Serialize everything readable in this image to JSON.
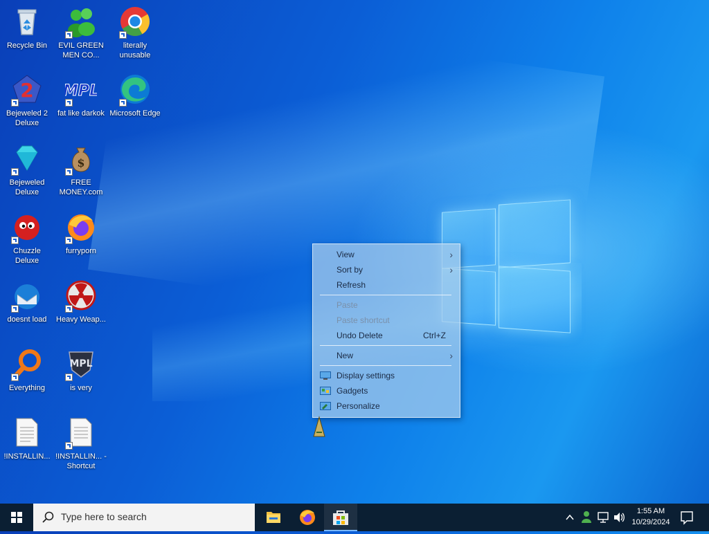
{
  "desktop_icons": [
    {
      "label": "Recycle Bin",
      "icon": "recycle-bin-icon",
      "shortcut": false
    },
    {
      "label": "EVIL GREEN MEN CO...",
      "icon": "green-men-icon",
      "shortcut": true
    },
    {
      "label": "literally unusable",
      "icon": "chrome-icon",
      "shortcut": true
    },
    {
      "label": "Bejeweled 2 Deluxe",
      "icon": "bejeweled-2-icon",
      "shortcut": true
    },
    {
      "label": "fat like darkok",
      "icon": "mpl-icon",
      "shortcut": true
    },
    {
      "label": "Microsoft Edge",
      "icon": "edge-icon",
      "shortcut": true
    },
    {
      "label": "Bejeweled Deluxe",
      "icon": "diamond-icon",
      "shortcut": true
    },
    {
      "label": "FREE MONEY.com",
      "icon": "money-bag-icon",
      "shortcut": true
    },
    {
      "label": "Chuzzle Deluxe",
      "icon": "chuzzle-icon",
      "shortcut": true
    },
    {
      "label": "furryporn",
      "icon": "firefox-icon",
      "shortcut": true
    },
    {
      "label": "doesnt load",
      "icon": "thunderbird-icon",
      "shortcut": true
    },
    {
      "label": "Heavy Weap...",
      "icon": "radiation-icon",
      "shortcut": true
    },
    {
      "label": "Everything",
      "icon": "search-magnifier-icon",
      "shortcut": true
    },
    {
      "label": "is very",
      "icon": "mpl-shield-icon",
      "shortcut": true
    },
    {
      "label": "!INSTALLIN...",
      "icon": "text-file-icon",
      "shortcut": false
    },
    {
      "label": "!INSTALLIN... - Shortcut",
      "icon": "text-file-icon",
      "shortcut": true
    }
  ],
  "context_menu": {
    "items": [
      {
        "label": "View",
        "submenu": true,
        "disabled": false
      },
      {
        "label": "Sort by",
        "submenu": true,
        "disabled": false
      },
      {
        "label": "Refresh",
        "disabled": false
      },
      {
        "label": "Paste",
        "disabled": true
      },
      {
        "label": "Paste shortcut",
        "disabled": true
      },
      {
        "label": "Undo Delete",
        "shortcut": "Ctrl+Z",
        "disabled": false
      },
      {
        "label": "New",
        "submenu": true,
        "disabled": false
      },
      {
        "label": "Display settings",
        "icon": "display-icon",
        "disabled": false
      },
      {
        "label": "Gadgets",
        "icon": "gadgets-icon",
        "disabled": false
      },
      {
        "label": "Personalize",
        "icon": "personalize-icon",
        "disabled": false
      }
    ]
  },
  "taskbar": {
    "search_placeholder": "Type here to search",
    "apps": [
      "file-explorer-icon",
      "firefox-icon",
      "microsoft-store-icon"
    ],
    "clock_time": "1:55 AM",
    "clock_date": "10/29/2024"
  },
  "colors": {
    "taskbar": "#0b1f33",
    "accent": "#1a5fd0"
  }
}
